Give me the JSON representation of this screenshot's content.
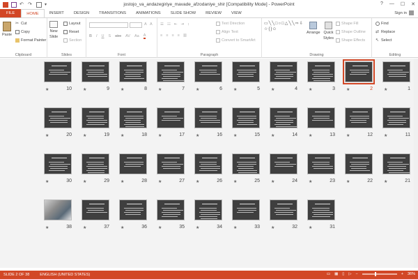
{
  "window": {
    "title": "jostojo_va_andazegiriye_mavade_afzodaniye_shir [Compatibility Mode] - PowerPoint",
    "controls": [
      "?",
      "—",
      "☐",
      "✕"
    ]
  },
  "tabs": [
    {
      "label": "FILE"
    },
    {
      "label": "HOME"
    },
    {
      "label": "INSERT"
    },
    {
      "label": "DESIGN"
    },
    {
      "label": "TRANSITIONS"
    },
    {
      "label": "ANIMATIONS"
    },
    {
      "label": "SLIDE SHOW"
    },
    {
      "label": "REVIEW"
    },
    {
      "label": "VIEW"
    }
  ],
  "signin": "Sign in",
  "ribbon": {
    "clipboard": {
      "label": "Clipboard",
      "paste": "Paste",
      "cut": "Cut",
      "copy": "Copy",
      "format_painter": "Format Painter"
    },
    "slides": {
      "label": "Slides",
      "new_slide": "New",
      "new_slide2": "Slide",
      "layout": "Layout",
      "reset": "Reset",
      "section": "Section"
    },
    "font": {
      "label": "Font"
    },
    "paragraph": {
      "label": "Paragraph",
      "text_direction": "Text Direction",
      "align_text": "Align Text",
      "convert": "Convert to SmartArt"
    },
    "drawing": {
      "label": "Drawing",
      "arrange": "Arrange",
      "quick_styles": "Quick",
      "quick_styles2": "Styles",
      "shape_fill": "Shape Fill",
      "shape_outline": "Shape Outline",
      "shape_effects": "Shape Effects"
    },
    "editing": {
      "label": "Editing",
      "find": "Find",
      "replace": "Replace",
      "select": "Select"
    }
  },
  "slides": {
    "selected": 2,
    "rows": [
      [
        "10",
        "9",
        "8",
        "7",
        "6",
        "5",
        "4",
        "3",
        "2",
        "1"
      ],
      [
        "20",
        "19",
        "18",
        "17",
        "16",
        "15",
        "14",
        "13",
        "12",
        "11"
      ],
      [
        "30",
        "29",
        "28",
        "27",
        "26",
        "25",
        "24",
        "23",
        "22",
        "21"
      ],
      [
        "38",
        "37",
        "36",
        "35",
        "34",
        "33",
        "32",
        "31"
      ]
    ]
  },
  "status": {
    "slide": "SLIDE 2 OF 38",
    "language": "ENGLISH (UNITED STATES)",
    "zoom": "36%"
  }
}
